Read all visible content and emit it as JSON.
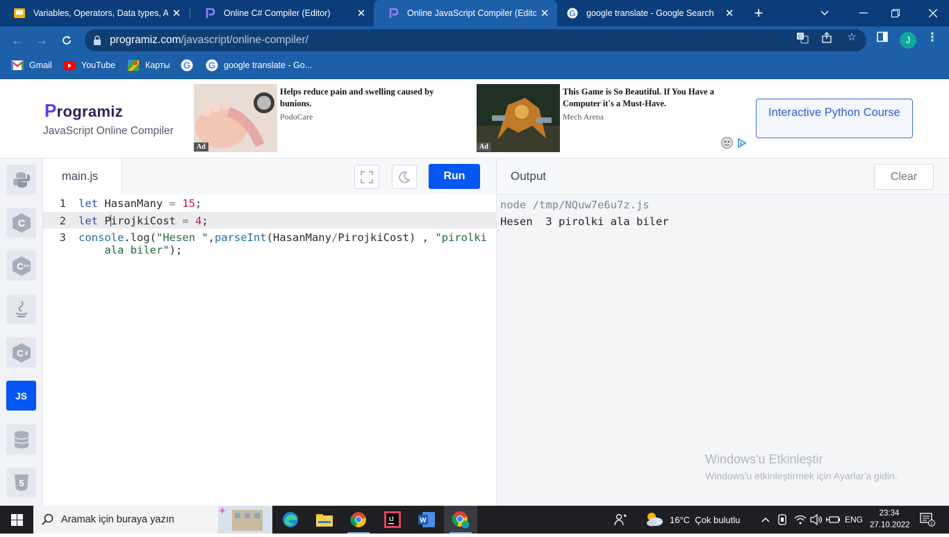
{
  "browser": {
    "tabs": [
      {
        "title": "Variables, Operators, Data types, Alg",
        "icon": "orange-slides-icon",
        "active": false
      },
      {
        "title": "Online C# Compiler (Editor)",
        "icon": "programiz-icon",
        "active": false
      },
      {
        "title": "Online JavaScript Compiler (Editor)",
        "icon": "programiz-icon",
        "active": true
      },
      {
        "title": "google translate - Google Search",
        "icon": "google-icon",
        "active": false
      }
    ],
    "url_domain": "programiz.com",
    "url_path": "/javascript/online-compiler/",
    "profile_initial": "J",
    "bookmarks": [
      {
        "label": "Gmail",
        "icon": "gmail-icon"
      },
      {
        "label": "YouTube",
        "icon": "youtube-icon"
      },
      {
        "label": "Карты",
        "icon": "maps-icon"
      },
      {
        "label": "",
        "icon": "google-icon"
      },
      {
        "label": "google translate - Go...",
        "icon": "google-icon"
      }
    ]
  },
  "header": {
    "logo_first": "P",
    "logo_rest": "rogramiz",
    "subtitle": "JavaScript Online Compiler",
    "ads": [
      {
        "headline": "Helps reduce pain and swelling caused by bunions.",
        "source": "PodoCare",
        "tag": "Ad"
      },
      {
        "headline": "This Game is So Beautiful. If You Have a Computer it's a Must-Have.",
        "source": "Mech Arena",
        "tag": "Ad"
      }
    ],
    "course_button": "Interactive Python Course"
  },
  "rail": {
    "items": [
      "python-icon",
      "c-icon",
      "cpp-icon",
      "java-icon",
      "csharp-icon",
      "js-icon",
      "sql-icon",
      "html5-icon"
    ],
    "active_label": "JS"
  },
  "editor": {
    "filename": "main.js",
    "run_label": "Run",
    "line_numbers": [
      "1",
      "2",
      "3"
    ]
  },
  "output": {
    "title": "Output",
    "clear_label": "Clear",
    "command": "node /tmp/NQuw7e6u7z.js",
    "result": "Hesen  3 pirolki ala biler"
  },
  "windows": {
    "activation_title": "Windows'u Etkinleştir",
    "activation_text": "Windows'u etkinleştirmek için Ayarlar'a gidin.",
    "search_placeholder": "Aramak için buraya yazın",
    "weather": "16°C  Çok bulutlu",
    "language": "ENG",
    "time": "23:34",
    "date": "27.10.2022",
    "notification_count": "1"
  },
  "colors": {
    "chrome_dark": "#0b3d7a",
    "chrome": "#1d5fa8",
    "run_blue": "#0556f3",
    "brand_purple": "#5a3bf0"
  }
}
